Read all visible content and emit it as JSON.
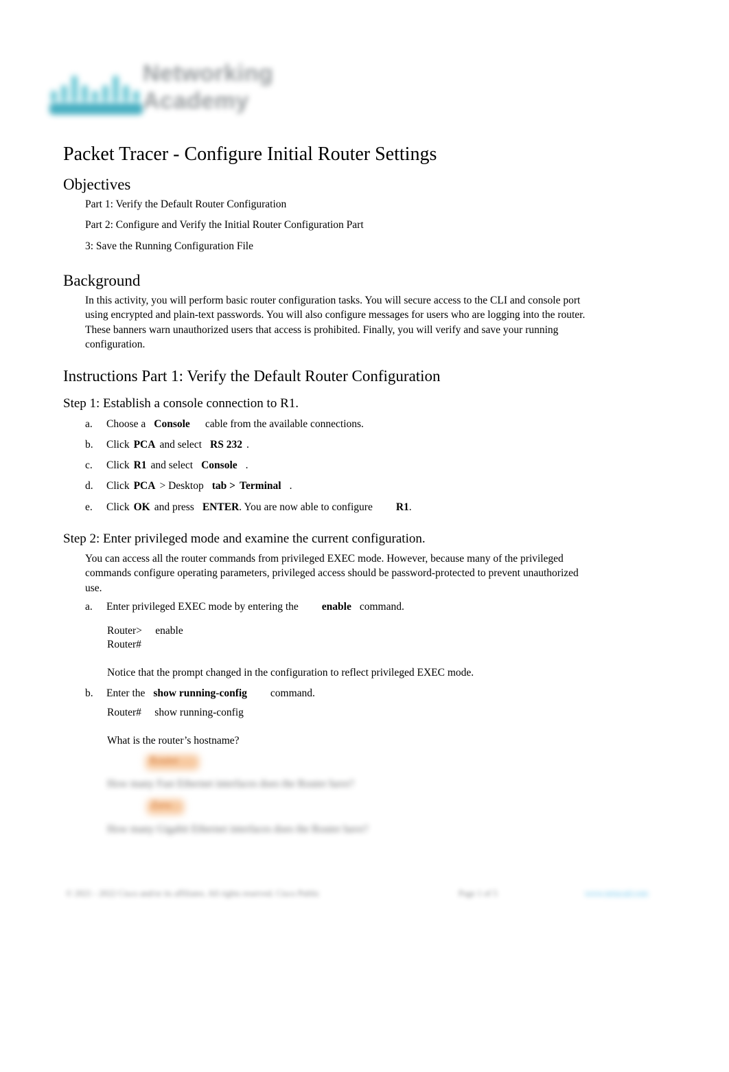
{
  "document": {
    "title": "Packet Tracer - Configure Initial Router Settings"
  },
  "logo": {
    "icon_name": "cisco-bridge-icon",
    "brand_line1": "Networking",
    "brand_line2": "Academy",
    "bridge_color": "#5bc2d0",
    "wordmark_color": "#8e9396"
  },
  "objectives": {
    "heading": "Objectives",
    "items": [
      "Part 1: Verify the Default Router Configuration",
      "Part 2: Configure and Verify the Initial Router Configuration Part",
      "3: Save the Running Configuration File"
    ]
  },
  "background": {
    "heading": "Background",
    "paragraph": "In this activity, you will perform basic router configuration tasks. You will secure access to the CLI and console port using encrypted and plain-text passwords. You will also configure messages for users who are logging into the router. These banners warn unauthorized users that access is prohibited. Finally, you will verify and save your running configuration."
  },
  "instructions": {
    "heading": "Instructions Part 1: Verify the Default Router Configuration",
    "step1": {
      "heading": "Step 1: Establish a console connection to R1.",
      "items": [
        {
          "marker": "a.",
          "pre": "Choose a",
          "bold1": "Console",
          "post": "cable from the available connections."
        },
        {
          "marker": "b.",
          "pre": "Click",
          "bold1": "PCA",
          "mid": "and select",
          "bold2": "RS 232",
          "post": "."
        },
        {
          "marker": "c.",
          "pre": "Click",
          "bold1": "R1",
          "mid": "and select",
          "bold2": "Console",
          "post": "."
        },
        {
          "marker": "d.",
          "pre": "Click",
          "bold1": "PCA",
          "mid": "> Desktop",
          "bold2": "tab >",
          "bold3": "Terminal",
          "post": "."
        },
        {
          "marker": "e.",
          "pre": "Click",
          "bold1": "OK",
          "mid": "and press",
          "bold2": "ENTER",
          "post": ". You are now able to configure",
          "bold3": "R1",
          "tail": "."
        }
      ]
    },
    "step2": {
      "heading": "Step 2: Enter privileged mode and examine the current configuration.",
      "paragraph": "You can access all the router commands from privileged EXEC mode. However, because many of the privileged commands configure operating parameters, privileged access should be password-protected to prevent unauthorized use.",
      "item_a": {
        "marker": "a.",
        "pre": "Enter privileged EXEC mode by entering the",
        "bold1": "enable",
        "post": "command."
      },
      "cli_block_1": "Router>     enable\nRouter#",
      "note": "Notice that the prompt changed in the configuration to reflect privileged EXEC mode.",
      "item_b": {
        "marker": "b.",
        "pre": "Enter the",
        "bold1": "show running-config",
        "post": "command."
      },
      "cli_block_2": "Router#     show running-config",
      "question_1": "What is the router’s hostname?",
      "answer_1": "Router",
      "question_2": "How many Fast Ethernet interfaces does the Router have?",
      "answer_2": "Zero",
      "question_3": "How many Gigabit Ethernet interfaces does the Router have?"
    }
  },
  "highlight": {
    "color": "#f7c9a0"
  },
  "footer": {
    "left": "© 2021 - 2022 Cisco and/or its affiliates. All rights reserved. Cisco Public",
    "center": "Page 1 of 5",
    "right": "www.netacad.com"
  }
}
